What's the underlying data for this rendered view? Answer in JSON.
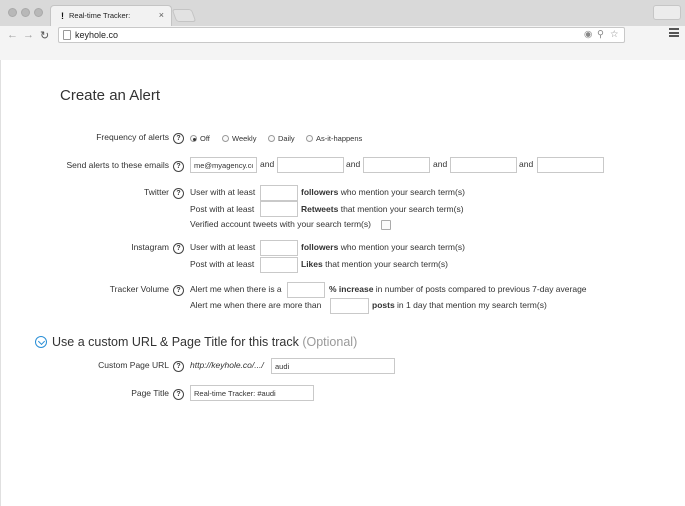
{
  "browser": {
    "tab_title": "Real-time Tracker:",
    "tab_close": "×",
    "url": "keyhole.co"
  },
  "page": {
    "title": "Create an Alert",
    "help_glyph": "?",
    "frequency": {
      "label": "Frequency of alerts",
      "options": [
        "Off",
        "Weekly",
        "Daily",
        "As-it-happens"
      ],
      "selected": "Off"
    },
    "emails": {
      "label": "Send alerts to these emails",
      "values": [
        "me@myagency.com",
        "",
        "",
        "",
        ""
      ],
      "conjunction": "and"
    },
    "twitter": {
      "label": "Twitter",
      "row1_prefix": "User with at least",
      "row1_bold": "followers",
      "row1_suffix": "who mention your search term(s)",
      "row2_prefix": "Post with at least",
      "row2_bold": "Retweets",
      "row2_suffix": "that mention your search term(s)",
      "verified_label": "Verified account tweets with your search term(s)"
    },
    "instagram": {
      "label": "Instagram",
      "row1_prefix": "User with at least",
      "row1_bold": "followers",
      "row1_suffix": "who mention your search term(s)",
      "row2_prefix": "Post with at least",
      "row2_bold": "Likes",
      "row2_suffix": "that mention your search term(s)"
    },
    "volume": {
      "label": "Tracker Volume",
      "row1_prefix": "Alert me when there is a",
      "row1_bold": "% increase",
      "row1_suffix": "in number of posts compared to previous 7-day average",
      "row2_prefix": "Alert me when there are more than",
      "row2_bold": "posts",
      "row2_suffix": "in 1 day that mention my search term(s)"
    },
    "custom": {
      "section_title": "Use a custom URL & Page Title for this track",
      "section_optional": "(Optional)",
      "url_label": "Custom Page URL",
      "url_prefix": "http://keyhole.co/.../",
      "url_value": "audi",
      "title_label": "Page Title",
      "title_value": "Real-time Tracker: #audi"
    }
  },
  "colors": {
    "accent": "#2a8fd6",
    "chrome": "#e4e4e4"
  }
}
